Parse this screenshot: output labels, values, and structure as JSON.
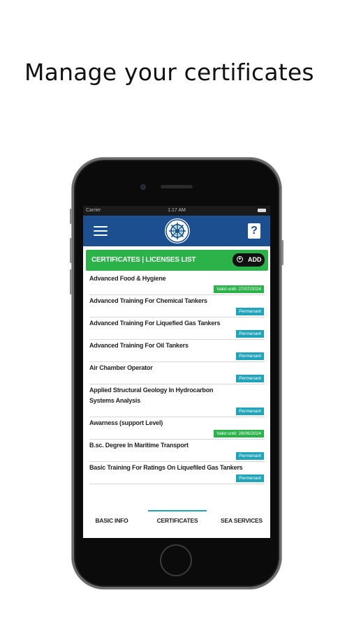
{
  "headline": "Manage your certificates",
  "status_bar": {
    "carrier": "Carrier",
    "time": "1:17 AM"
  },
  "app_bar": {
    "menu_icon": "hamburger-menu-icon",
    "logo_icon": "ship-wheel-logo-icon",
    "help_label": "?"
  },
  "list_header": {
    "title": "CERTIFICATES | LICENSES LIST",
    "add_label": "ADD",
    "add_icon": "plus-circle-icon"
  },
  "certificates": [
    {
      "name": "Advanced Food & Hygiene",
      "status": "Valid until:  27/07/2024"
    },
    {
      "name": "Advanced Training For Chemical Tankers",
      "status": "Permenant"
    },
    {
      "name": "Advanced Training For Liquefied Gas Tankers",
      "status": "Permenant"
    },
    {
      "name": "Advanced Training For Oil Tankers",
      "status": "Permenant"
    },
    {
      "name": "Air  Chamber Operator",
      "status": "Permenant"
    },
    {
      "name": "Applied Structural Geology In Hydrocarbon Systems Analysis",
      "status": "Permenant"
    },
    {
      "name": "Awarness (support Level)",
      "status": "Valid until:  28/06/2024"
    },
    {
      "name": "B.sc. Degree In Maritime Transport",
      "status": "Permenant"
    },
    {
      "name": "Basic Training For Ratings On Liquefiled Gas Tankers",
      "status": "Permenant"
    }
  ],
  "tabs": [
    {
      "label": "BASIC INFO",
      "active": false
    },
    {
      "label": "CERTIFICATES",
      "active": true
    },
    {
      "label": "SEA SERVICES",
      "active": false
    }
  ],
  "colors": {
    "app_bar": "#1b4f8f",
    "list_header": "#2bb34a",
    "valid_badge": "#2bb34a",
    "permanent_badge": "#1fa4b9"
  }
}
